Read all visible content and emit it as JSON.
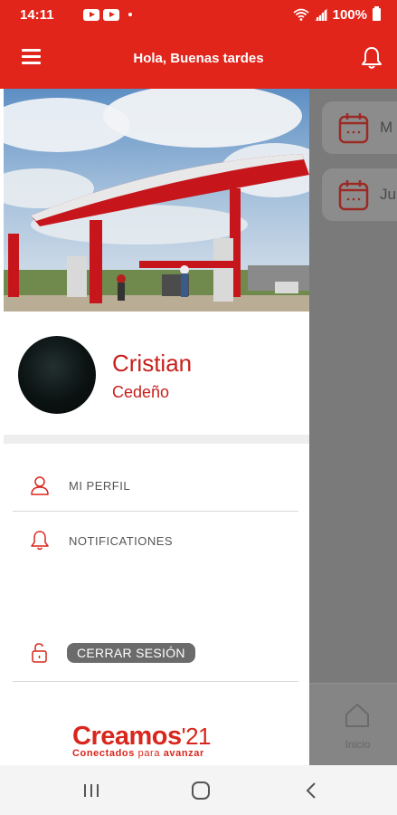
{
  "status_bar": {
    "time": "14:11",
    "battery": "100%",
    "icons": [
      "youtube-icon",
      "youtube-icon",
      "notification-dot",
      "wifi-icon",
      "signal-icon",
      "battery-icon"
    ]
  },
  "app_bar": {
    "title": "Hola, Buenas tardes",
    "menu_icon": "hamburger-menu-icon",
    "bell_icon": "bell-icon"
  },
  "background_page": {
    "cards": [
      {
        "label": "M",
        "icon": "calendar-icon"
      },
      {
        "label": "Ju",
        "icon": "calendar-icon"
      }
    ],
    "bottom_nav": {
      "label": "Inicio",
      "icon": "home-icon"
    }
  },
  "drawer": {
    "user": {
      "first_name": "Cristian",
      "last_name": "Cedeño"
    },
    "menu": [
      {
        "label": "MI PERFIL",
        "icon": "user-icon"
      },
      {
        "label": "NOTIFICATIONES",
        "icon": "bell-icon"
      }
    ],
    "logout": {
      "label": "CERRAR SESIÓN",
      "icon": "unlock-icon"
    },
    "brand": {
      "name": "Creamos",
      "year": "'21",
      "tagline_1": "Conectados",
      "tagline_2": "para",
      "tagline_3": "avanzar"
    }
  },
  "colors": {
    "primary": "#e1251b",
    "brand_text": "#c8201c",
    "overlay": "#7a7a7a"
  },
  "system_nav": {
    "icons": [
      "recent-apps-icon",
      "home-circle-icon",
      "back-chevron-icon"
    ]
  }
}
